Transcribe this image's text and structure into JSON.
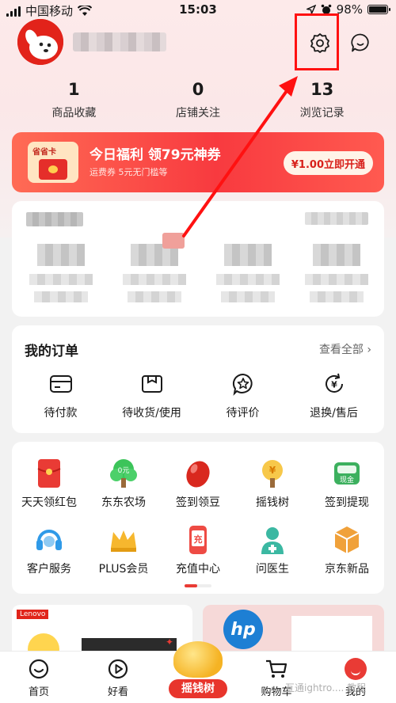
{
  "status_bar": {
    "carrier": "中国移动",
    "time": "15:03",
    "battery": "98%",
    "battery_level": 0.98
  },
  "header": {
    "username": "(blurred)",
    "settings_icon": "gear-icon",
    "message_icon": "chat-bubble-icon"
  },
  "stats": [
    {
      "value": "1",
      "label": "商品收藏"
    },
    {
      "value": "0",
      "label": "店铺关注"
    },
    {
      "value": "13",
      "label": "浏览记录"
    }
  ],
  "promo": {
    "badge": "省省卡",
    "title": "今日福利 领79元神券",
    "subtitle": "运费券 5元无门槛等",
    "button": "¥1.00立即开通"
  },
  "orders": {
    "title": "我的订单",
    "view_all": "查看全部 ›",
    "items": [
      {
        "label": "待付款",
        "icon": "wallet-icon"
      },
      {
        "label": "待收货/使用",
        "icon": "package-icon"
      },
      {
        "label": "待评价",
        "icon": "star-badge-icon"
      },
      {
        "label": "退换/售后",
        "icon": "refund-icon"
      }
    ]
  },
  "services": [
    {
      "label": "天天领红包",
      "icon": "red-envelope-icon",
      "color": "#e93b35"
    },
    {
      "label": "东东农场",
      "icon": "tree-icon",
      "color": "#3cc45a"
    },
    {
      "label": "签到领豆",
      "icon": "bean-icon",
      "color": "#d9281e"
    },
    {
      "label": "摇钱树",
      "icon": "money-tree-icon",
      "color": "#f5a623"
    },
    {
      "label": "签到提现",
      "icon": "cash-icon",
      "color": "#3cb05e"
    },
    {
      "label": "客户服务",
      "icon": "headset-icon",
      "color": "#2f9ae8"
    },
    {
      "label": "PLUS会员",
      "icon": "crown-icon",
      "color": "#f6b72e"
    },
    {
      "label": "充值中心",
      "icon": "phone-recharge-icon",
      "color": "#ee4b44"
    },
    {
      "label": "问医生",
      "icon": "doctor-icon",
      "color": "#3bb8a2"
    },
    {
      "label": "京东新品",
      "icon": "new-product-icon",
      "color": "#f0a13a"
    }
  ],
  "ads": {
    "left_brand": "Lenovo",
    "right_brand": "hp"
  },
  "tabbar": [
    {
      "label": "首页",
      "icon": "home-icon"
    },
    {
      "label": "好看",
      "icon": "play-icon"
    },
    {
      "label": "摇钱树",
      "icon": "money-bag-icon"
    },
    {
      "label": "购物车",
      "icon": "cart-icon"
    },
    {
      "label": "我的",
      "icon": "profile-icon"
    }
  ],
  "watermark": "互通ightro.... 教程",
  "colors": {
    "brand_red": "#e93b35",
    "annotation_red": "#ff1111"
  }
}
